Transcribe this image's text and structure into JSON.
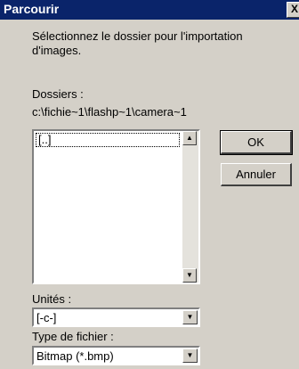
{
  "dialog": {
    "title": "Parcourir",
    "close_label": "X",
    "instruction": "Sélectionnez le dossier pour l'importation d'images.",
    "folders_label": "Dossiers :",
    "current_path": "c:\\fichie~1\\flashp~1\\camera~1",
    "folder_items": [
      "[..]"
    ],
    "ok_label": "OK",
    "cancel_label": "Annuler",
    "drives_label": "Unités :",
    "drive_value": "[-c-]",
    "filetype_label": "Type de fichier :",
    "filetype_value": "Bitmap (*.bmp)"
  },
  "colors": {
    "titlebar": "#0a246a",
    "face": "#d4d0c8"
  }
}
